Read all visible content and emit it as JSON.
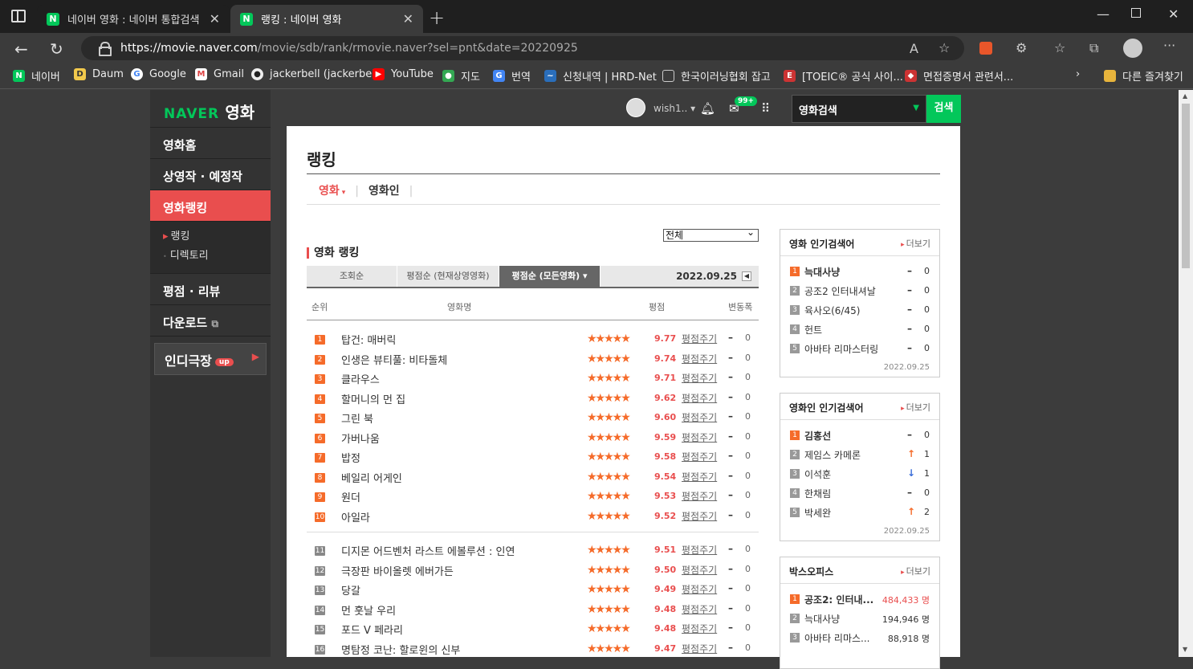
{
  "browser": {
    "tabs": [
      {
        "title": "네이버 영화 : 네이버 통합검색",
        "fav": "N"
      },
      {
        "title": "랭킹 : 네이버 영화",
        "fav": "N"
      }
    ],
    "url_host": "https://movie.naver.com",
    "url_path": "/movie/sdb/rank/rmovie.naver?sel=pnt&date=20220925",
    "bookmarks": [
      "네이버",
      "Daum",
      "Google",
      "Gmail",
      "jackerbell (jackerbell)",
      "YouTube",
      "지도",
      "번역",
      "신청내역 | HRD-Net",
      "한국이러닝협회 잡고",
      "[TOEIC® 공식 사이...",
      "면접증명서 관련서...",
      "다른 즐겨찾기"
    ]
  },
  "lnb": {
    "logo_brand": "NAVER",
    "logo_title": "영화",
    "menu": [
      "영화홈",
      "상영작 · 예정작",
      "영화랭킹"
    ],
    "sub": [
      "랭킹",
      "디렉토리"
    ],
    "menu2": [
      "평점 · 리뷰",
      "다운로드"
    ],
    "indie": "인디극장",
    "indie_badge": "up"
  },
  "gnb": {
    "user": "wish1.. ▾",
    "mail_badge": "99+",
    "search_label": "영화검색",
    "search_button": "검색"
  },
  "content": {
    "title": "랭킹",
    "subtabs": [
      "영화",
      "영화인"
    ],
    "select_value": "전체",
    "section_title": "영화 랭킹",
    "sort_tabs": [
      "조회순",
      "평점순 (현재상영영화)",
      "평점순 (모든영화) ▾"
    ],
    "date": "2022.09.25",
    "headers": [
      "순위",
      "영화명",
      "평점",
      "변동폭"
    ],
    "rate_label": "평점주기",
    "rows": [
      {
        "rank": "1",
        "title": "탑건: 매버릭",
        "score": "9.77",
        "change": "0"
      },
      {
        "rank": "2",
        "title": "인생은 뷰티풀: 비타돌체",
        "score": "9.74",
        "change": "0"
      },
      {
        "rank": "3",
        "title": "클라우스",
        "score": "9.71",
        "change": "0"
      },
      {
        "rank": "4",
        "title": "할머니의 먼 집",
        "score": "9.62",
        "change": "0"
      },
      {
        "rank": "5",
        "title": "그린 북",
        "score": "9.60",
        "change": "0"
      },
      {
        "rank": "6",
        "title": "가버나움",
        "score": "9.59",
        "change": "0"
      },
      {
        "rank": "7",
        "title": "밥정",
        "score": "9.58",
        "change": "0"
      },
      {
        "rank": "8",
        "title": "베일리 어게인",
        "score": "9.54",
        "change": "0"
      },
      {
        "rank": "9",
        "title": "원더",
        "score": "9.53",
        "change": "0"
      },
      {
        "rank": "10",
        "title": "아일라",
        "score": "9.52",
        "change": "0"
      },
      {
        "rank": "11",
        "title": "디지몬 어드벤처 라스트 에볼루션 : 인연",
        "score": "9.51",
        "change": "0"
      },
      {
        "rank": "12",
        "title": "극장판 바이올렛 에버가든",
        "score": "9.50",
        "change": "0"
      },
      {
        "rank": "13",
        "title": "당갈",
        "score": "9.49",
        "change": "0"
      },
      {
        "rank": "14",
        "title": "먼 훗날 우리",
        "score": "9.48",
        "change": "0"
      },
      {
        "rank": "15",
        "title": "포드 V 페라리",
        "score": "9.48",
        "change": "0"
      },
      {
        "rank": "16",
        "title": "명탐정 코난: 할로윈의 신부",
        "score": "9.47",
        "change": "0"
      }
    ]
  },
  "side": {
    "more_label": "더보기",
    "box1": {
      "title": "영화 인기검색어",
      "items": [
        {
          "n": "1",
          "name": "늑대사냥",
          "dir": "–",
          "c": "0"
        },
        {
          "n": "2",
          "name": "공조2 인터내셔날",
          "dir": "–",
          "c": "0"
        },
        {
          "n": "3",
          "name": "육사오(6/45)",
          "dir": "–",
          "c": "0"
        },
        {
          "n": "4",
          "name": "헌트",
          "dir": "–",
          "c": "0"
        },
        {
          "n": "5",
          "name": "아바타 리마스터링",
          "dir": "–",
          "c": "0"
        }
      ],
      "date": "2022.09.25"
    },
    "box2": {
      "title": "영화인 인기검색어",
      "items": [
        {
          "n": "1",
          "name": "김홍선",
          "dir": "–",
          "c": "0"
        },
        {
          "n": "2",
          "name": "제임스 카메론",
          "dir": "↑",
          "c": "1"
        },
        {
          "n": "3",
          "name": "이석훈",
          "dir": "↓",
          "c": "1"
        },
        {
          "n": "4",
          "name": "한채림",
          "dir": "–",
          "c": "0"
        },
        {
          "n": "5",
          "name": "박세완",
          "dir": "↑",
          "c": "2"
        }
      ],
      "date": "2022.09.25"
    },
    "box3": {
      "title": "박스오피스",
      "items": [
        {
          "n": "1",
          "name": "공조2: 인터내...",
          "aud": "484,433 명"
        },
        {
          "n": "2",
          "name": "늑대사냥",
          "aud": "194,946 명"
        },
        {
          "n": "3",
          "name": "아바타 리마스...",
          "aud": "88,918 명"
        }
      ]
    }
  },
  "colors": {
    "naver_green": "#03c75a",
    "accent_red": "#e94e4e",
    "star_orange": "#f56b2a"
  }
}
